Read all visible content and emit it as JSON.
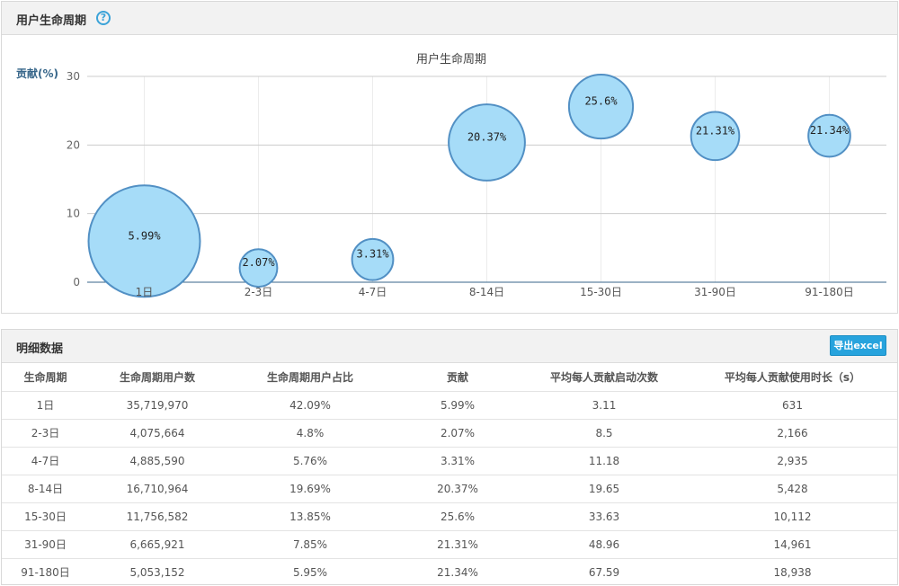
{
  "chart_panel": {
    "title": "用户生命周期",
    "help_icon": "help-icon"
  },
  "chart_data": {
    "type": "scatter",
    "title": "用户生命周期",
    "ylabel": "贡献(%)",
    "ylim": [
      0,
      30
    ],
    "yticks": [
      "30",
      "20",
      "10",
      "0"
    ],
    "categories": [
      "1日",
      "2-3日",
      "4-7日",
      "8-14日",
      "15-30日",
      "31-90日",
      "91-180日"
    ],
    "values": [
      5.99,
      2.07,
      3.31,
      20.37,
      25.6,
      21.31,
      21.34
    ],
    "labels": [
      "5.99%",
      "2.07%",
      "3.31%",
      "20.37%",
      "25.6%",
      "21.31%",
      "21.34%"
    ],
    "bubble_size_by": "生命周期用户占比",
    "sizes": [
      42.09,
      4.8,
      5.76,
      19.69,
      13.85,
      7.85,
      5.95
    ],
    "grid": true,
    "colors": {
      "fill": "#a6dcf8",
      "stroke": "#5290c4",
      "grid": "#cccccc",
      "axis": "#37668a"
    }
  },
  "table_panel": {
    "title": "明细数据",
    "export_label": "导出excel"
  },
  "table": {
    "headers": [
      "生命周期",
      "生命周期用户数",
      "生命周期用户占比",
      "贡献",
      "平均每人贡献启动次数",
      "平均每人贡献使用时长（s）"
    ],
    "rows": [
      [
        "1日",
        "35,719,970",
        "42.09%",
        "5.99%",
        "3.11",
        "631"
      ],
      [
        "2-3日",
        "4,075,664",
        "4.8%",
        "2.07%",
        "8.5",
        "2,166"
      ],
      [
        "4-7日",
        "4,885,590",
        "5.76%",
        "3.31%",
        "11.18",
        "2,935"
      ],
      [
        "8-14日",
        "16,710,964",
        "19.69%",
        "20.37%",
        "19.65",
        "5,428"
      ],
      [
        "15-30日",
        "11,756,582",
        "13.85%",
        "25.6%",
        "33.63",
        "10,112"
      ],
      [
        "31-90日",
        "6,665,921",
        "7.85%",
        "21.31%",
        "48.96",
        "14,961"
      ],
      [
        "91-180日",
        "5,053,152",
        "5.95%",
        "21.34%",
        "67.59",
        "18,938"
      ]
    ]
  }
}
